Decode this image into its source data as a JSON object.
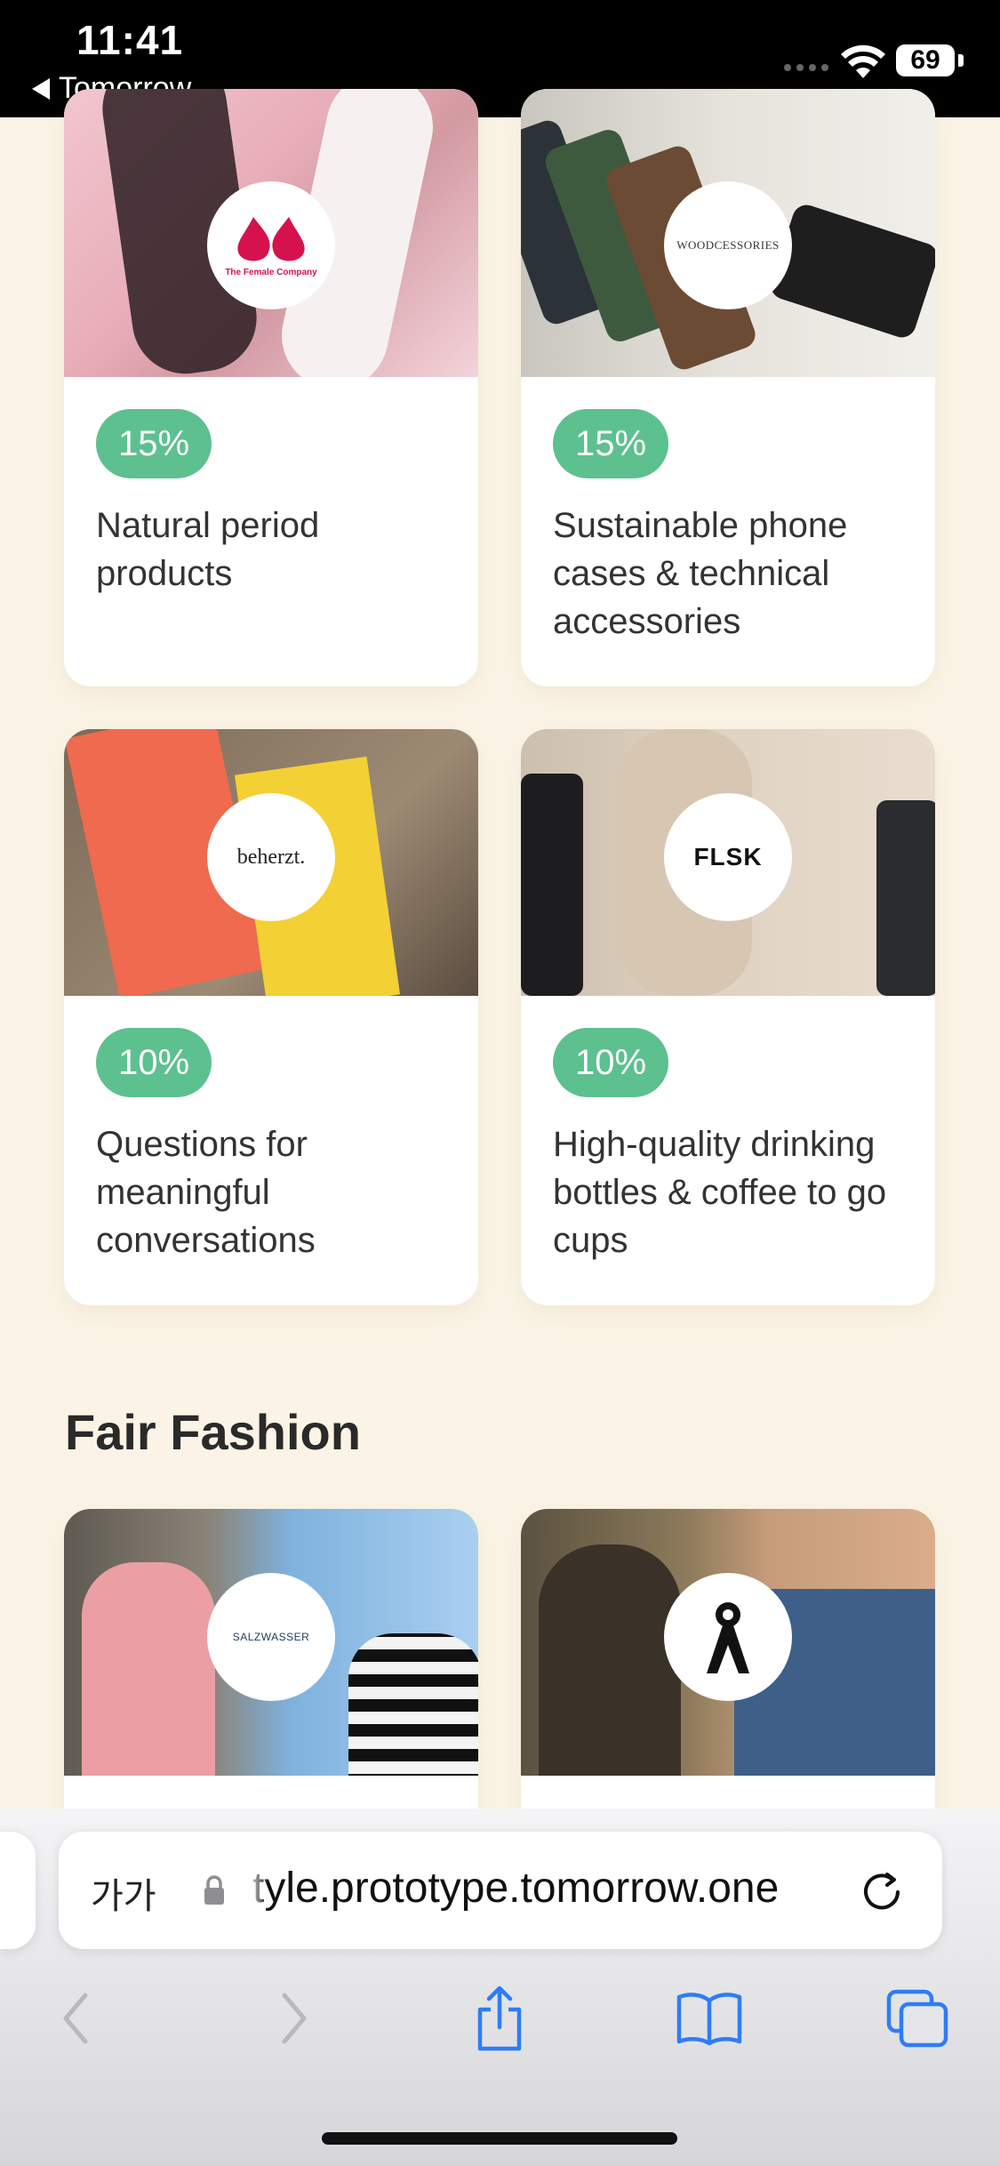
{
  "status_bar": {
    "time": "11:41",
    "back_app": "Tomorrow",
    "battery": "69"
  },
  "cards": [
    {
      "logo": "The Female Company",
      "discount": "15%",
      "description": "Natural period products"
    },
    {
      "logo": "WOODCESSORIES",
      "discount": "15%",
      "description": "Sustainable phone cases & technical accessories"
    },
    {
      "logo": "beherzt.",
      "discount": "10%",
      "description": "Questions for meaningful conversations"
    },
    {
      "logo": "FLSK",
      "discount": "10%",
      "description": "High-quality drinking bottles & coffee to go cups"
    }
  ],
  "section": {
    "title": "Fair Fashion"
  },
  "fashion_cards": [
    {
      "logo": "SALZWASSER"
    },
    {
      "logo": "A"
    }
  ],
  "browser": {
    "text_size_label": "가가",
    "url": "tyle.prototype.tomorrow.one"
  },
  "icons": {
    "back": "chevron-left-icon",
    "forward": "chevron-right-icon",
    "share": "share-icon",
    "bookmarks": "book-icon",
    "tabs": "tabs-icon",
    "reload": "reload-icon",
    "lock": "lock-icon"
  },
  "colors": {
    "badge": "#5dc08f",
    "page_bg": "#fbf4e6",
    "ios_blue": "#2f7cf6"
  }
}
